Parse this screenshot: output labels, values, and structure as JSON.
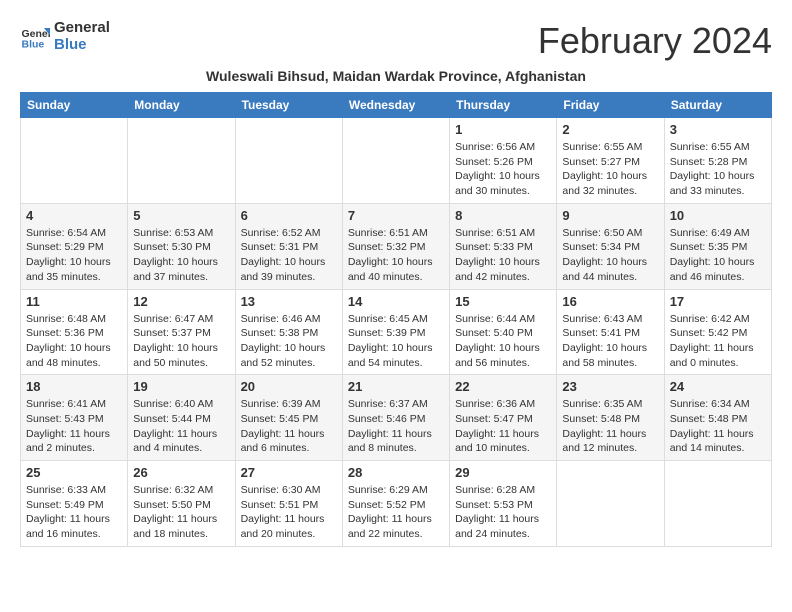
{
  "logo": {
    "line1": "General",
    "line2": "Blue"
  },
  "header": {
    "month_year": "February 2024",
    "location": "Wuleswali Bihsud, Maidan Wardak Province, Afghanistan"
  },
  "weekdays": [
    "Sunday",
    "Monday",
    "Tuesday",
    "Wednesday",
    "Thursday",
    "Friday",
    "Saturday"
  ],
  "weeks": [
    [
      {
        "day": "",
        "info": ""
      },
      {
        "day": "",
        "info": ""
      },
      {
        "day": "",
        "info": ""
      },
      {
        "day": "",
        "info": ""
      },
      {
        "day": "1",
        "info": "Sunrise: 6:56 AM\nSunset: 5:26 PM\nDaylight: 10 hours\nand 30 minutes."
      },
      {
        "day": "2",
        "info": "Sunrise: 6:55 AM\nSunset: 5:27 PM\nDaylight: 10 hours\nand 32 minutes."
      },
      {
        "day": "3",
        "info": "Sunrise: 6:55 AM\nSunset: 5:28 PM\nDaylight: 10 hours\nand 33 minutes."
      }
    ],
    [
      {
        "day": "4",
        "info": "Sunrise: 6:54 AM\nSunset: 5:29 PM\nDaylight: 10 hours\nand 35 minutes."
      },
      {
        "day": "5",
        "info": "Sunrise: 6:53 AM\nSunset: 5:30 PM\nDaylight: 10 hours\nand 37 minutes."
      },
      {
        "day": "6",
        "info": "Sunrise: 6:52 AM\nSunset: 5:31 PM\nDaylight: 10 hours\nand 39 minutes."
      },
      {
        "day": "7",
        "info": "Sunrise: 6:51 AM\nSunset: 5:32 PM\nDaylight: 10 hours\nand 40 minutes."
      },
      {
        "day": "8",
        "info": "Sunrise: 6:51 AM\nSunset: 5:33 PM\nDaylight: 10 hours\nand 42 minutes."
      },
      {
        "day": "9",
        "info": "Sunrise: 6:50 AM\nSunset: 5:34 PM\nDaylight: 10 hours\nand 44 minutes."
      },
      {
        "day": "10",
        "info": "Sunrise: 6:49 AM\nSunset: 5:35 PM\nDaylight: 10 hours\nand 46 minutes."
      }
    ],
    [
      {
        "day": "11",
        "info": "Sunrise: 6:48 AM\nSunset: 5:36 PM\nDaylight: 10 hours\nand 48 minutes."
      },
      {
        "day": "12",
        "info": "Sunrise: 6:47 AM\nSunset: 5:37 PM\nDaylight: 10 hours\nand 50 minutes."
      },
      {
        "day": "13",
        "info": "Sunrise: 6:46 AM\nSunset: 5:38 PM\nDaylight: 10 hours\nand 52 minutes."
      },
      {
        "day": "14",
        "info": "Sunrise: 6:45 AM\nSunset: 5:39 PM\nDaylight: 10 hours\nand 54 minutes."
      },
      {
        "day": "15",
        "info": "Sunrise: 6:44 AM\nSunset: 5:40 PM\nDaylight: 10 hours\nand 56 minutes."
      },
      {
        "day": "16",
        "info": "Sunrise: 6:43 AM\nSunset: 5:41 PM\nDaylight: 10 hours\nand 58 minutes."
      },
      {
        "day": "17",
        "info": "Sunrise: 6:42 AM\nSunset: 5:42 PM\nDaylight: 11 hours\nand 0 minutes."
      }
    ],
    [
      {
        "day": "18",
        "info": "Sunrise: 6:41 AM\nSunset: 5:43 PM\nDaylight: 11 hours\nand 2 minutes."
      },
      {
        "day": "19",
        "info": "Sunrise: 6:40 AM\nSunset: 5:44 PM\nDaylight: 11 hours\nand 4 minutes."
      },
      {
        "day": "20",
        "info": "Sunrise: 6:39 AM\nSunset: 5:45 PM\nDaylight: 11 hours\nand 6 minutes."
      },
      {
        "day": "21",
        "info": "Sunrise: 6:37 AM\nSunset: 5:46 PM\nDaylight: 11 hours\nand 8 minutes."
      },
      {
        "day": "22",
        "info": "Sunrise: 6:36 AM\nSunset: 5:47 PM\nDaylight: 11 hours\nand 10 minutes."
      },
      {
        "day": "23",
        "info": "Sunrise: 6:35 AM\nSunset: 5:48 PM\nDaylight: 11 hours\nand 12 minutes."
      },
      {
        "day": "24",
        "info": "Sunrise: 6:34 AM\nSunset: 5:48 PM\nDaylight: 11 hours\nand 14 minutes."
      }
    ],
    [
      {
        "day": "25",
        "info": "Sunrise: 6:33 AM\nSunset: 5:49 PM\nDaylight: 11 hours\nand 16 minutes."
      },
      {
        "day": "26",
        "info": "Sunrise: 6:32 AM\nSunset: 5:50 PM\nDaylight: 11 hours\nand 18 minutes."
      },
      {
        "day": "27",
        "info": "Sunrise: 6:30 AM\nSunset: 5:51 PM\nDaylight: 11 hours\nand 20 minutes."
      },
      {
        "day": "28",
        "info": "Sunrise: 6:29 AM\nSunset: 5:52 PM\nDaylight: 11 hours\nand 22 minutes."
      },
      {
        "day": "29",
        "info": "Sunrise: 6:28 AM\nSunset: 5:53 PM\nDaylight: 11 hours\nand 24 minutes."
      },
      {
        "day": "",
        "info": ""
      },
      {
        "day": "",
        "info": ""
      }
    ]
  ]
}
